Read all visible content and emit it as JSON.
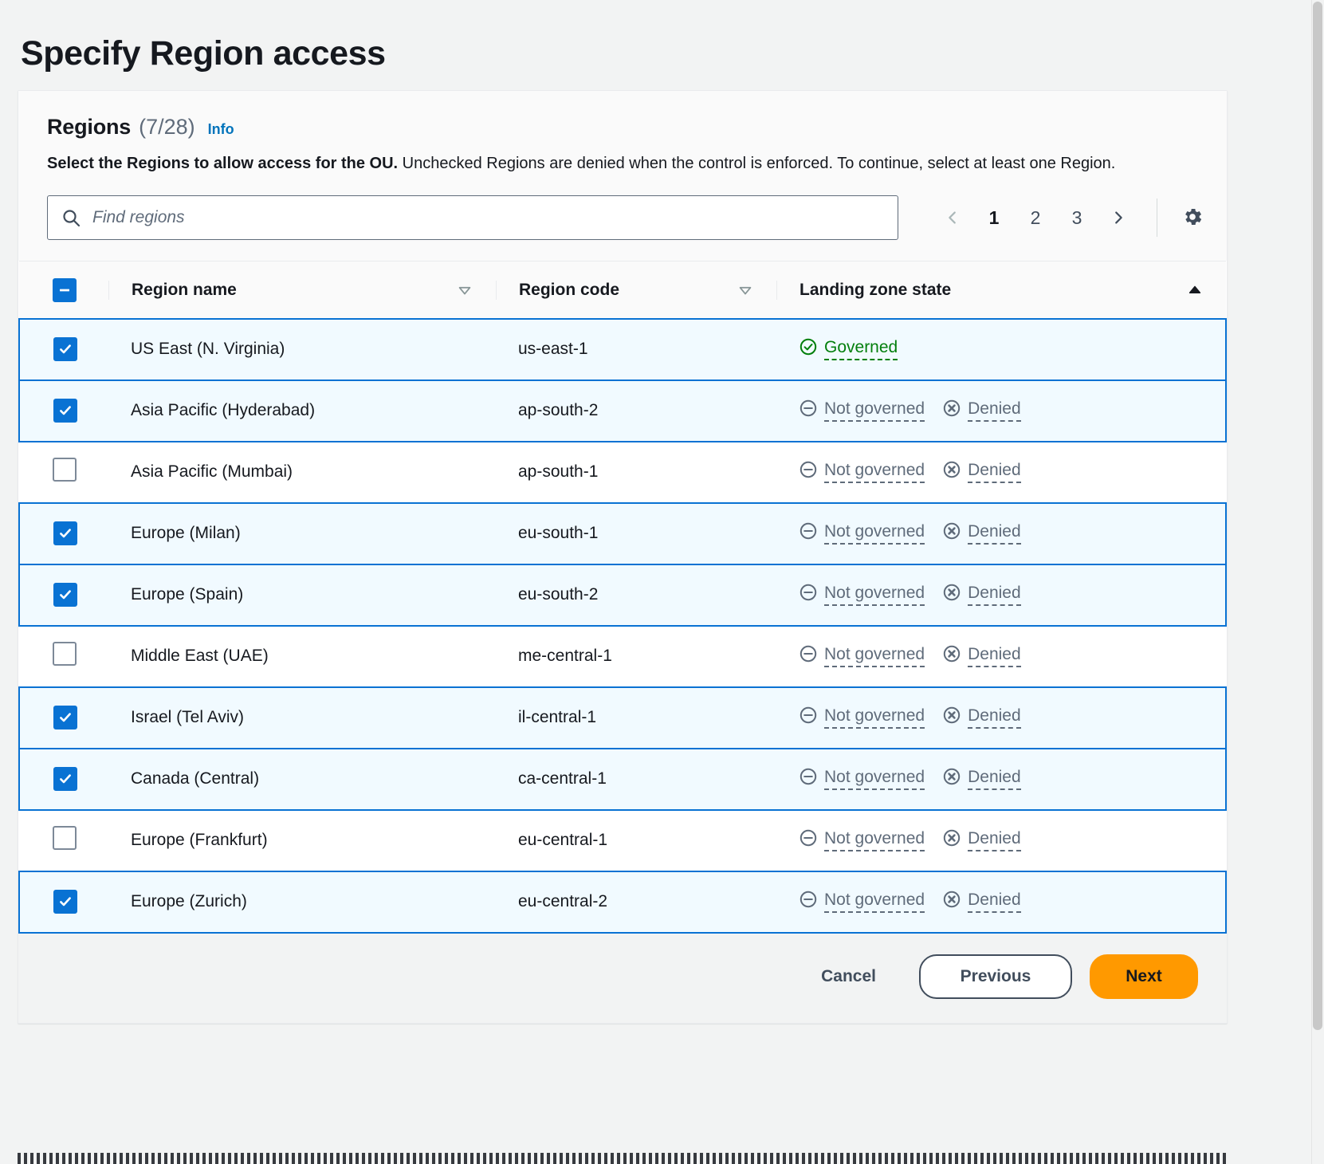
{
  "page": {
    "title": "Specify Region access"
  },
  "panel": {
    "heading": "Regions",
    "count": "(7/28)",
    "info_label": "Info",
    "description_bold": "Select the Regions to allow access for the OU.",
    "description_rest": " Unchecked Regions are denied when the control is enforced. To continue, select at least one Region."
  },
  "search": {
    "placeholder": "Find regions",
    "value": "",
    "icon": "search-icon"
  },
  "pagination": {
    "prev_label": "‹",
    "next_label": "›",
    "pages": [
      "1",
      "2",
      "3"
    ],
    "current_page": "1",
    "settings_icon": "gear-icon"
  },
  "table": {
    "select_all_state": "indeterminate",
    "columns": [
      {
        "label": "Region name",
        "sort": "inactive"
      },
      {
        "label": "Region code",
        "sort": "inactive"
      },
      {
        "label": "Landing zone state",
        "sort": "ascending"
      }
    ],
    "rows": [
      {
        "checked": true,
        "name": "US East (N. Virginia)",
        "code": "us-east-1",
        "states": [
          {
            "label": "Governed",
            "icon": "circle-check-icon",
            "tone": "governed"
          }
        ]
      },
      {
        "checked": true,
        "name": "Asia Pacific (Hyderabad)",
        "code": "ap-south-2",
        "states": [
          {
            "label": "Not governed",
            "icon": "circle-minus-icon",
            "tone": "muted"
          },
          {
            "label": "Denied",
            "icon": "circle-x-icon",
            "tone": "muted"
          }
        ]
      },
      {
        "checked": false,
        "name": "Asia Pacific (Mumbai)",
        "code": "ap-south-1",
        "states": [
          {
            "label": "Not governed",
            "icon": "circle-minus-icon",
            "tone": "muted"
          },
          {
            "label": "Denied",
            "icon": "circle-x-icon",
            "tone": "muted"
          }
        ]
      },
      {
        "checked": true,
        "name": "Europe (Milan)",
        "code": "eu-south-1",
        "states": [
          {
            "label": "Not governed",
            "icon": "circle-minus-icon",
            "tone": "muted"
          },
          {
            "label": "Denied",
            "icon": "circle-x-icon",
            "tone": "muted"
          }
        ]
      },
      {
        "checked": true,
        "name": "Europe (Spain)",
        "code": "eu-south-2",
        "states": [
          {
            "label": "Not governed",
            "icon": "circle-minus-icon",
            "tone": "muted"
          },
          {
            "label": "Denied",
            "icon": "circle-x-icon",
            "tone": "muted"
          }
        ]
      },
      {
        "checked": false,
        "name": "Middle East (UAE)",
        "code": "me-central-1",
        "states": [
          {
            "label": "Not governed",
            "icon": "circle-minus-icon",
            "tone": "muted"
          },
          {
            "label": "Denied",
            "icon": "circle-x-icon",
            "tone": "muted"
          }
        ]
      },
      {
        "checked": true,
        "name": "Israel (Tel Aviv)",
        "code": "il-central-1",
        "states": [
          {
            "label": "Not governed",
            "icon": "circle-minus-icon",
            "tone": "muted"
          },
          {
            "label": "Denied",
            "icon": "circle-x-icon",
            "tone": "muted"
          }
        ]
      },
      {
        "checked": true,
        "name": "Canada (Central)",
        "code": "ca-central-1",
        "states": [
          {
            "label": "Not governed",
            "icon": "circle-minus-icon",
            "tone": "muted"
          },
          {
            "label": "Denied",
            "icon": "circle-x-icon",
            "tone": "muted"
          }
        ]
      },
      {
        "checked": false,
        "name": "Europe (Frankfurt)",
        "code": "eu-central-1",
        "states": [
          {
            "label": "Not governed",
            "icon": "circle-minus-icon",
            "tone": "muted"
          },
          {
            "label": "Denied",
            "icon": "circle-x-icon",
            "tone": "muted"
          }
        ]
      },
      {
        "checked": true,
        "name": "Europe (Zurich)",
        "code": "eu-central-2",
        "states": [
          {
            "label": "Not governed",
            "icon": "circle-minus-icon",
            "tone": "muted"
          },
          {
            "label": "Denied",
            "icon": "circle-x-icon",
            "tone": "muted"
          }
        ]
      }
    ]
  },
  "footer": {
    "cancel_label": "Cancel",
    "previous_label": "Previous",
    "next_label": "Next"
  },
  "colors": {
    "accent_blue": "#0972d3",
    "link_blue": "#0073bb",
    "governed_green": "#037f0c",
    "muted_gray": "#5f6b7a",
    "primary_orange": "#ff9900",
    "selected_row_bg": "#f1faff"
  }
}
